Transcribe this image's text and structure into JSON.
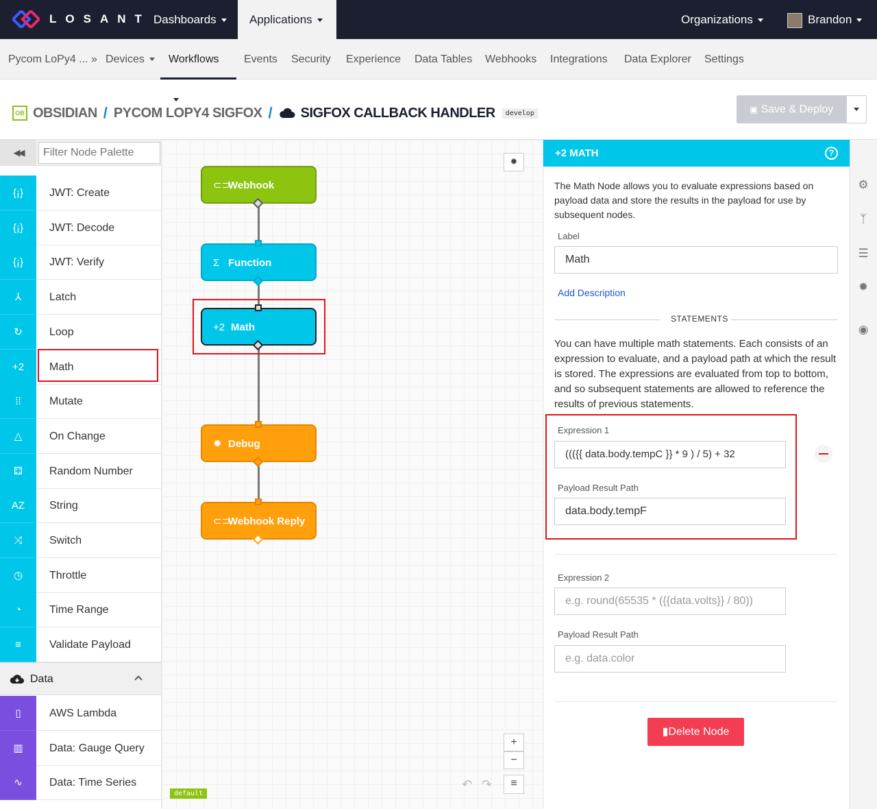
{
  "topnav": {
    "brand": "LOSANT",
    "dashboards": "Dashboards",
    "applications": "Applications",
    "organizations": "Organizations",
    "user": "Brandon"
  },
  "subnav": {
    "app": "Pycom LoPy4 ... »",
    "devices": "Devices",
    "workflows": "Workflows",
    "events": "Events",
    "security": "Security",
    "experience": "Experience",
    "data_tables": "Data Tables",
    "webhooks": "Webhooks",
    "integrations": "Integrations",
    "data_explorer": "Data Explorer",
    "settings": "Settings"
  },
  "breadcrumb": {
    "badge": "OB",
    "org": "OBSIDIAN",
    "app": "PYCOM LOPY4 SIGFOX",
    "workflow": "SIGFOX CALLBACK HANDLER",
    "version": "develop"
  },
  "toolbar": {
    "save_label": "Save & Deploy"
  },
  "palette": {
    "filter_placeholder": "Filter Node Palette",
    "logic_items": [
      {
        "icon": "{¡}",
        "label": "JWT: Create"
      },
      {
        "icon": "{¡}",
        "label": "JWT: Decode"
      },
      {
        "icon": "{¡}",
        "label": "JWT: Verify"
      },
      {
        "icon": "⅄",
        "label": "Latch"
      },
      {
        "icon": "↻",
        "label": "Loop"
      },
      {
        "icon": "+2",
        "label": "Math"
      },
      {
        "icon": "⁞⁞",
        "label": "Mutate"
      },
      {
        "icon": "△",
        "label": "On Change"
      },
      {
        "icon": "⚃",
        "label": "Random Number"
      },
      {
        "icon": "AZ",
        "label": "String"
      },
      {
        "icon": "⤨",
        "label": "Switch"
      },
      {
        "icon": "◷",
        "label": "Throttle"
      },
      {
        "icon": "◔",
        "label": "Time Range"
      },
      {
        "icon": "≡",
        "label": "Validate Payload"
      }
    ],
    "data_section": "Data",
    "data_items": [
      {
        "icon": "▯",
        "label": "AWS Lambda"
      },
      {
        "icon": "▥",
        "label": "Data: Gauge Query"
      },
      {
        "icon": "∿",
        "label": "Data: Time Series"
      }
    ]
  },
  "canvas": {
    "nodes": [
      {
        "icon": "⊂⊃",
        "label": "Webhook"
      },
      {
        "icon": "Σ",
        "label": "Function"
      },
      {
        "icon": "+2",
        "label": "Math"
      },
      {
        "icon": "✹",
        "label": "Debug"
      },
      {
        "icon": "⊂⊃",
        "label": "Webhook Reply"
      }
    ],
    "badge": "default",
    "zoom_in": "+",
    "zoom_out": "−"
  },
  "panel": {
    "title": "+2 MATH",
    "description": "The Math Node allows you to evaluate expressions based on payload data and store the results in the payload for use by subsequent nodes.",
    "label_label": "Label",
    "label_value": "Math",
    "add_description": "Add Description",
    "statements_title": "STATEMENTS",
    "statements_help": "You can have multiple math statements. Each consists of an expression to evaluate, and a payload path at which the result is stored. The expressions are evaluated from top to bottom, and so subsequent statements are allowed to reference the results of previous statements.",
    "expr1_label": "Expression 1",
    "expr1_value": "((({{ data.body.tempC }} * 9 ) / 5) + 32",
    "path1_label": "Payload Result Path",
    "path1_value": "data.body.tempF",
    "expr2_label": "Expression 2",
    "expr2_placeholder": "e.g. round(65535 * ({{data.volts}} / 80))",
    "path2_label": "Payload Result Path",
    "path2_placeholder": "e.g. data.color",
    "delete_label": "Delete Node"
  },
  "colors": {
    "nav_bg": "#1b1f2f",
    "logic": "#00c7ea",
    "data": "#7a4fe0",
    "green_node": "#8cc410",
    "orange_node": "#ff9f0c",
    "delete": "#f23d52",
    "highlight": "#e3101a"
  }
}
